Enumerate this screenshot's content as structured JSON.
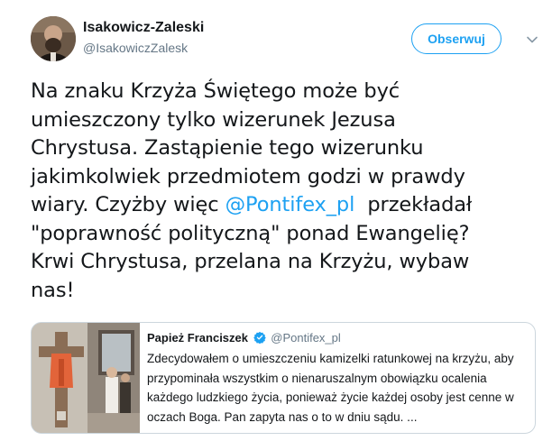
{
  "author": {
    "name": "Isakowicz-Zaleski",
    "handle": "@IsakowiczZalesk",
    "avatar_icon": "profile-photo"
  },
  "follow_button": {
    "label": "Obserwuj"
  },
  "menu": {
    "icon": "chevron-down-icon"
  },
  "tweet": {
    "lines": [
      "Na znaku Krzyża Świętego może być",
      "umieszczony tylko wizerunek Jezusa",
      "Chrystusa. Zastąpienie tego wizerunku",
      "jakimkolwiek przedmiotem godzi w prawdy"
    ],
    "line5_before": "wiary. Czyżby więc ",
    "mention": "@Pontifex_pl",
    "line5_after": "  przekładał",
    "line6": "\"poprawność polityczną\" ponad Ewangelię?",
    "line7": "Krwi Chrystusa, przelana na Krzyżu, wybaw",
    "line8": "nas!"
  },
  "quoted": {
    "name": "Papież Franciszek",
    "handle": "@Pontifex_pl",
    "verified_icon": "verified-badge-icon",
    "lines": [
      "Zdecydowałem o umieszczeniu kamizelki ratunkowej na krzyżu, aby",
      "przypominała wszystkim o nienaruszalnym obowiązku ocalenia",
      "każdego ludzkiego życia, ponieważ życie każdej osoby jest cenne w",
      "oczach Boga. Pan zapyta nas o to w dniu sądu. ..."
    ]
  },
  "colors": {
    "accent": "#1da1f2",
    "text": "#14171a",
    "secondary": "#657786",
    "border": "#ccd6dd"
  }
}
